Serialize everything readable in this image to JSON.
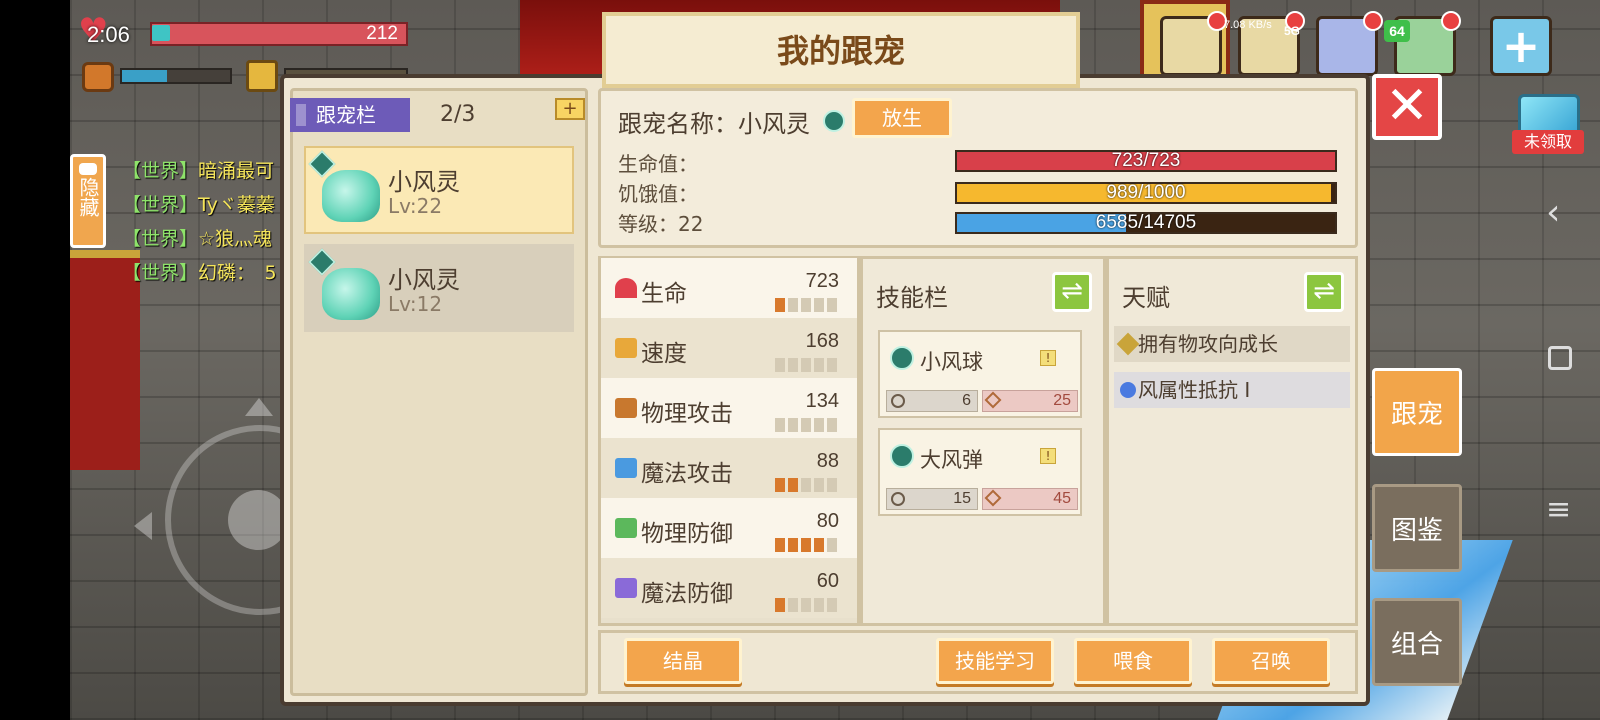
{
  "hud": {
    "time": "2:06",
    "hp_value": "212",
    "status": {
      "net_speed": "7.08 KB/s",
      "network": "5G",
      "battery": "64"
    }
  },
  "chat": {
    "hide_label": "隐藏",
    "lines": [
      {
        "channel": "【世界】",
        "text": "暗涌最可"
      },
      {
        "channel": "【世界】",
        "text": "Tyヾ蓁蓁"
      },
      {
        "channel": "【世界】",
        "text": "☆狼灬魂"
      },
      {
        "channel": "【世界】",
        "text": "幻磷：　5"
      }
    ]
  },
  "dialog": {
    "title": "我的跟宠",
    "pet_list": {
      "tab_label": "跟宠栏",
      "count": "2/3",
      "add_label": "+",
      "pets": [
        {
          "name": "小风灵",
          "level": "Lv:22",
          "selected": true
        },
        {
          "name": "小风灵",
          "level": "Lv:12",
          "selected": false
        }
      ]
    },
    "info": {
      "name_label": "跟宠名称：小风灵",
      "release_label": "放生",
      "hp": {
        "label": "生命值：",
        "text": "723/723",
        "fraction": 1.0,
        "color": "#d8404a"
      },
      "hunger": {
        "label": "饥饿值：",
        "text": "989/1000",
        "fraction": 0.989,
        "color": "#f6b82e"
      },
      "level": {
        "label": "等级：22",
        "text": "6585/14705",
        "fraction": 0.448,
        "color": "#4aa3e4"
      }
    },
    "attributes": [
      {
        "label": "生命",
        "value": "723",
        "pips": 1,
        "icon": "heart-icon",
        "color": "#e0404c"
      },
      {
        "label": "速度",
        "value": "168",
        "pips": 0,
        "icon": "boot-icon",
        "color": "#e8a83a"
      },
      {
        "label": "物理攻击",
        "value": "134",
        "pips": 0,
        "icon": "fist-icon",
        "color": "#c8782e"
      },
      {
        "label": "魔法攻击",
        "value": "88",
        "pips": 2,
        "icon": "magic-hand-icon",
        "color": "#4a9ae0"
      },
      {
        "label": "物理防御",
        "value": "80",
        "pips": 4,
        "icon": "shield-icon",
        "color": "#5cb85c"
      },
      {
        "label": "魔法防御",
        "value": "60",
        "pips": 1,
        "icon": "magic-shield-icon",
        "color": "#8a6ad8"
      }
    ],
    "skills": {
      "title": "技能栏",
      "swap_label": "⇌",
      "items": [
        {
          "name": "小风球",
          "cooldown": "6",
          "cost": "25"
        },
        {
          "name": "大风弹",
          "cooldown": "15",
          "cost": "45"
        }
      ]
    },
    "talent": {
      "title": "天赋",
      "swap_label": "⇌",
      "items": [
        "拥有物攻向成长",
        "风属性抵抗 I"
      ]
    },
    "buttons": {
      "crystal": "结晶",
      "learn_skill": "技能学习",
      "feed": "喂食",
      "summon": "召唤"
    }
  },
  "side_tabs": [
    {
      "label": "跟宠",
      "active": true
    },
    {
      "label": "图鉴",
      "active": false
    },
    {
      "label": "组合",
      "active": false
    }
  ],
  "reward_label": "未领取",
  "close_label": "✕"
}
